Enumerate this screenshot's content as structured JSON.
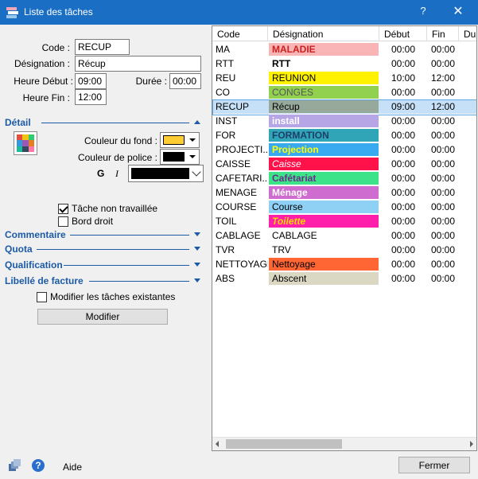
{
  "window": {
    "title": "Liste des tâches",
    "help_glyph": "?",
    "close_glyph": "✕",
    "icon": "task-list-icon"
  },
  "form": {
    "code_label": "Code :",
    "code_value": "RECUP",
    "designation_label": "Désignation :",
    "designation_value": "Récup",
    "heure_debut_label": "Heure Début :",
    "heure_debut_value": "09:00",
    "duree_label": "Durée :",
    "duree_value": "00:00",
    "heure_fin_label": "Heure Fin :",
    "heure_fin_value": "12:00"
  },
  "detail": {
    "title": "Détail",
    "couleur_fond_label": "Couleur du fond :",
    "couleur_fond": "#ffcc33",
    "couleur_police_label": "Couleur de police :",
    "couleur_police": "#000000",
    "bold_label": "G",
    "italic_label": "I",
    "tache_non_travaillee_label": "Tâche non travaillée",
    "tache_non_travaillee": true,
    "bord_droit_label": "Bord droit",
    "bord_droit": false
  },
  "sections": {
    "commentaire": "Commentaire",
    "quota": "Quota",
    "qualification": "Qualification",
    "libelle_facture": "Libellé de facture"
  },
  "modifier_existantes_label": "Modifier les tâches existantes",
  "modifier_existantes": false,
  "modifier_button": "Modifier",
  "table": {
    "columns": [
      "Code",
      "Désignation",
      "Début",
      "Fin",
      "Du"
    ],
    "selected_index": 4,
    "rows": [
      {
        "code": "MA",
        "designation": "MALADIE",
        "debut": "00:00",
        "fin": "00:00",
        "bg": "#f9b5b5",
        "fg": "#cc1f1f",
        "bold": true,
        "italic": false
      },
      {
        "code": "RTT",
        "designation": "RTT",
        "debut": "00:00",
        "fin": "00:00",
        "bg": "#ffffff",
        "fg": "#000000",
        "bold": true,
        "italic": false
      },
      {
        "code": "REU",
        "designation": "REUNION",
        "debut": "10:00",
        "fin": "12:00",
        "bg": "#fff200",
        "fg": "#000000",
        "bold": false,
        "italic": false
      },
      {
        "code": "CO",
        "designation": "CONGES",
        "debut": "00:00",
        "fin": "00:00",
        "bg": "#92d050",
        "fg": "#555555",
        "bold": false,
        "italic": false
      },
      {
        "code": "RECUP",
        "designation": "Récup",
        "debut": "09:00",
        "fin": "12:00",
        "bg": "#97a99b",
        "fg": "#000000",
        "bold": false,
        "italic": false
      },
      {
        "code": "INST",
        "designation": "install",
        "debut": "00:00",
        "fin": "00:00",
        "bg": "#b7a6e6",
        "fg": "#ffffff",
        "bold": true,
        "italic": false
      },
      {
        "code": "FOR",
        "designation": "FORMATION",
        "debut": "00:00",
        "fin": "00:00",
        "bg": "#31a5b8",
        "fg": "#1d3f66",
        "bold": true,
        "italic": false
      },
      {
        "code": "PROJECTI...",
        "designation": "Projection",
        "debut": "00:00",
        "fin": "00:00",
        "bg": "#39a9f0",
        "fg": "#ffff00",
        "bold": true,
        "italic": false
      },
      {
        "code": "CAISSE",
        "designation": "Caisse",
        "debut": "00:00",
        "fin": "00:00",
        "bg": "#ff1149",
        "fg": "#ffffff",
        "bold": false,
        "italic": true
      },
      {
        "code": "CAFETARI...",
        "designation": "Cafétariat",
        "debut": "00:00",
        "fin": "00:00",
        "bg": "#3de388",
        "fg": "#6a2c8a",
        "bold": true,
        "italic": false
      },
      {
        "code": "MENAGE",
        "designation": "Ménage",
        "debut": "00:00",
        "fin": "00:00",
        "bg": "#cf6ccf",
        "fg": "#ffffff",
        "bold": true,
        "italic": false
      },
      {
        "code": "COURSE",
        "designation": "Course",
        "debut": "00:00",
        "fin": "00:00",
        "bg": "#8fd0f5",
        "fg": "#000000",
        "bold": false,
        "italic": false
      },
      {
        "code": "TOIL",
        "designation": "Toilette",
        "debut": "00:00",
        "fin": "00:00",
        "bg": "#ff1faa",
        "fg": "#ffd700",
        "bold": true,
        "italic": true
      },
      {
        "code": "CABLAGE",
        "designation": "CABLAGE",
        "debut": "00:00",
        "fin": "00:00",
        "bg": "#ffffff",
        "fg": "#000000",
        "bold": false,
        "italic": false
      },
      {
        "code": "TVR",
        "designation": "TRV",
        "debut": "00:00",
        "fin": "00:00",
        "bg": "#ffffff",
        "fg": "#000000",
        "bold": false,
        "italic": false
      },
      {
        "code": "NETTOYAGE",
        "designation": "Nettoyage",
        "debut": "00:00",
        "fin": "00:00",
        "bg": "#ff6633",
        "fg": "#000000",
        "bold": false,
        "italic": false
      },
      {
        "code": "ABS",
        "designation": "Abscent",
        "debut": "00:00",
        "fin": "00:00",
        "bg": "#dad7c2",
        "fg": "#000000",
        "bold": false,
        "italic": false
      }
    ]
  },
  "footer": {
    "aide_label": "Aide",
    "fermer_button": "Fermer"
  }
}
